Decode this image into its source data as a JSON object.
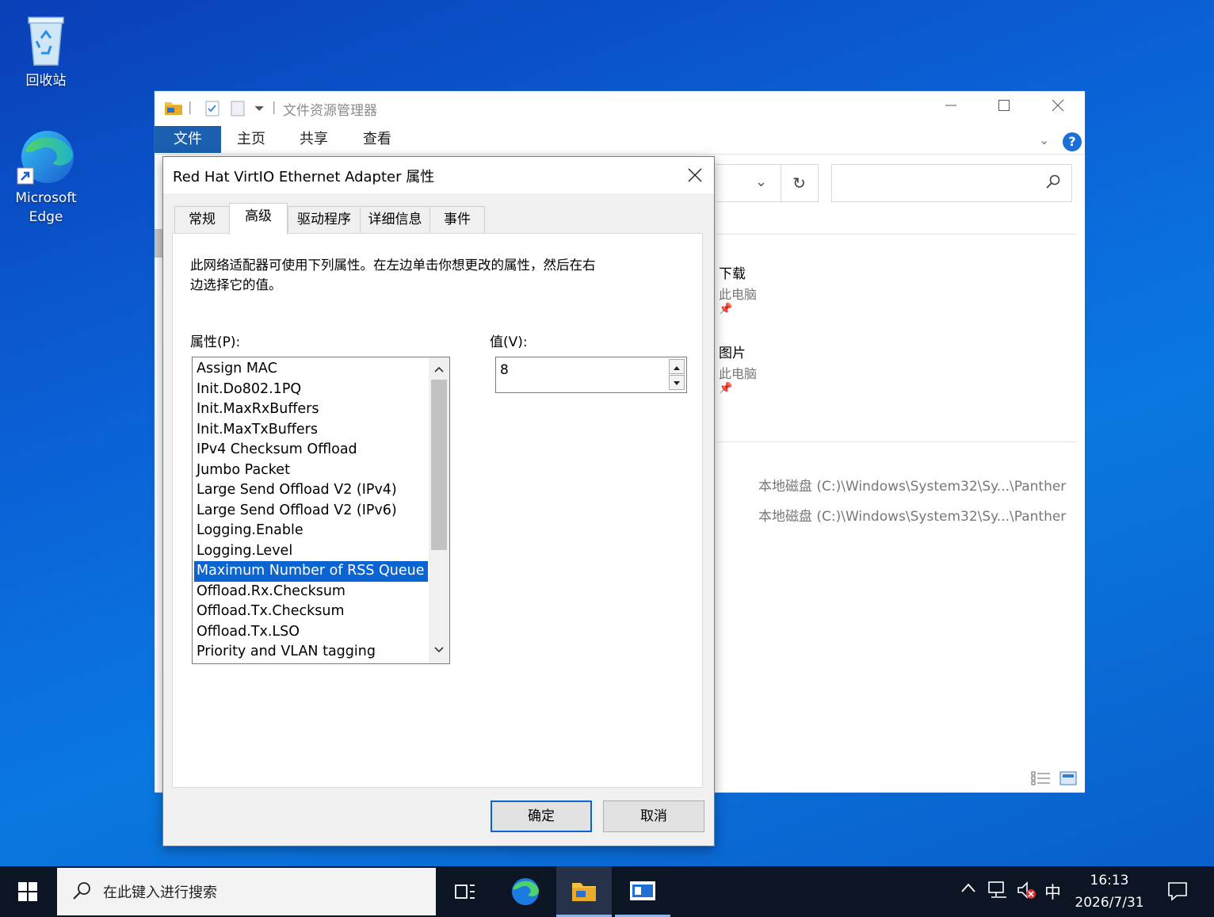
{
  "desktop": {
    "icons": [
      {
        "label": "回收站"
      },
      {
        "label_line1": "Microsoft",
        "label_line2": "Edge"
      }
    ]
  },
  "explorer": {
    "title": "文件资源管理器",
    "ribbon_tabs": [
      "文件",
      "主页",
      "共享",
      "查看"
    ],
    "quick_access": [
      {
        "name": "下载",
        "sub": "此电脑"
      },
      {
        "name": "图片",
        "sub": "此电脑"
      }
    ],
    "recent_paths": [
      "本地磁盘 (C:)\\Windows\\System32\\Sy...\\Panther",
      "本地磁盘 (C:)\\Windows\\System32\\Sy...\\Panther"
    ],
    "help_label": "?",
    "colors": {
      "ribbon_active": "#1a5fb0",
      "border": "#1d68c9"
    }
  },
  "dialog": {
    "title": "Red Hat VirtIO Ethernet Adapter 属性",
    "tabs": [
      "常规",
      "高级",
      "驱动程序",
      "详细信息",
      "事件"
    ],
    "active_tab": "高级",
    "description_line1": "此网络适配器可使用下列属性。在左边单击你想更改的属性，然后在右",
    "description_line2": "边选择它的值。",
    "property_label": "属性(P):",
    "value_label": "值(V):",
    "properties": [
      "Assign MAC",
      "Init.Do802.1PQ",
      "Init.MaxRxBuffers",
      "Init.MaxTxBuffers",
      "IPv4 Checksum Offload",
      "Jumbo Packet",
      "Large Send Offload V2 (IPv4)",
      "Large Send Offload V2 (IPv6)",
      "Logging.Enable",
      "Logging.Level",
      "Maximum Number of RSS Queue",
      "Offload.Rx.Checksum",
      "Offload.Tx.Checksum",
      "Offload.Tx.LSO",
      "Priority and VLAN tagging"
    ],
    "selected_property": "Maximum Number of RSS Queue",
    "value": "8",
    "ok_label": "确定",
    "cancel_label": "取消",
    "colors": {
      "selection": "#0a64d2"
    }
  },
  "taskbar": {
    "search_placeholder": "在此键入进行搜索",
    "ime": "中",
    "time": "16:13",
    "date": "2026/7/31"
  }
}
